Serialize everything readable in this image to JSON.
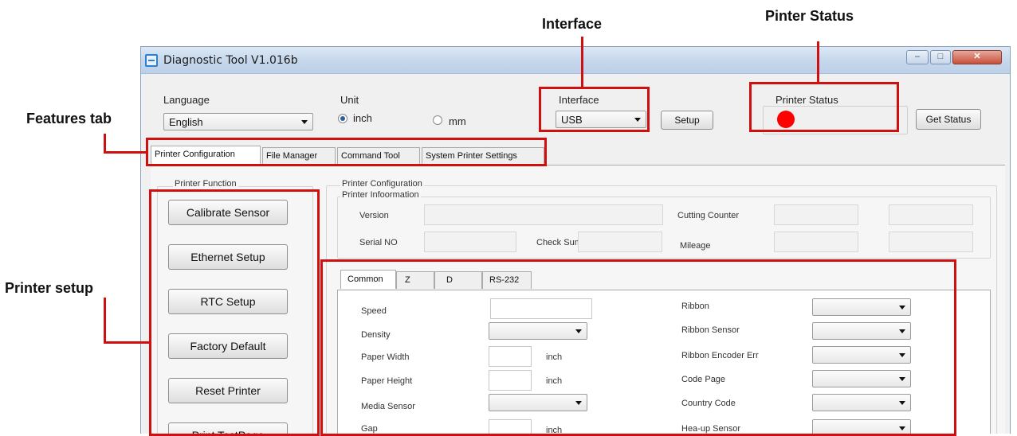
{
  "callouts": {
    "interface": "Interface",
    "printer_status": "Pinter Status",
    "features_tab": "Features tab",
    "printer_setup": "Printer setup"
  },
  "colors": {
    "highlight": "#d01010",
    "status_indicator": "#ff0000"
  },
  "window": {
    "title": "Diagnostic Tool V1.016b",
    "icon": "app-icon"
  },
  "header": {
    "language_label": "Language",
    "language_value": "English",
    "unit_label": "Unit",
    "unit_options": [
      "inch",
      "mm"
    ],
    "unit_selected": "inch",
    "interface_label": "Interface",
    "interface_value": "USB",
    "setup_button": "Setup",
    "printer_status_label": "Printer  Status",
    "get_status_button": "Get Status"
  },
  "tabs": [
    "Printer Configuration",
    "File Manager",
    "Command Tool",
    "System Printer Settings"
  ],
  "printer_function": {
    "title": "Printer  Function",
    "buttons": [
      "Calibrate Sensor",
      "Ethernet Setup",
      "RTC Setup",
      "Factory Default",
      "Reset Printer",
      "Print TestPage"
    ]
  },
  "printer_configuration": {
    "title": "Printer Configuration",
    "info_title": "Printer Infoormation",
    "version_label": "Version",
    "cutting_counter_label": "Cutting Counter",
    "serial_label": "Serial NO",
    "checksum_label": "Check Sum",
    "mileage_label": "Mileage"
  },
  "sub_tabs": [
    "Common",
    "Z",
    "D",
    "RS-232"
  ],
  "common": {
    "left": {
      "speed": "Speed",
      "density": "Density",
      "paper_width": "Paper Width",
      "paper_height": "Paper Height",
      "media_sensor": "Media Sensor",
      "gap": "Gap",
      "unit": "inch"
    },
    "right": [
      "Ribbon",
      "Ribbon  Sensor",
      "Ribbon Encoder Err",
      "Code Page",
      "Country Code",
      "Hea-up  Sensor"
    ]
  }
}
